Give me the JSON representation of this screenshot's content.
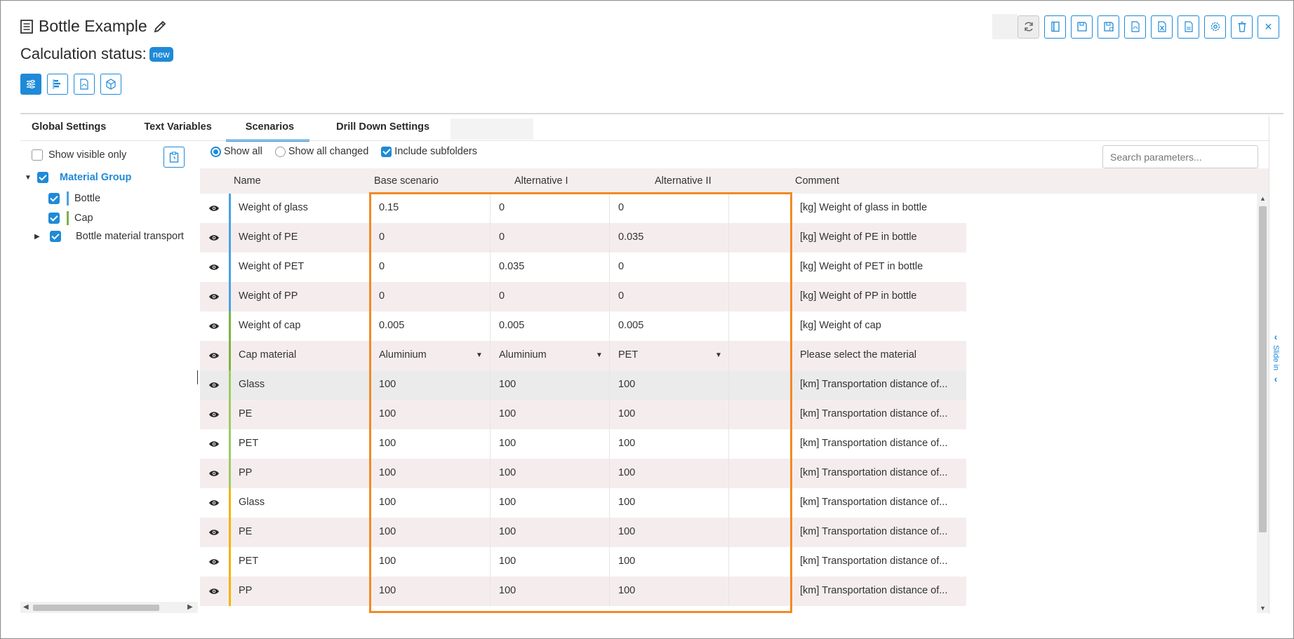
{
  "window": {
    "title": "Bottle Example",
    "status_label": "Calculation status:",
    "status_badge": "new"
  },
  "view_buttons": [
    "parameters-icon",
    "tree-structure-icon",
    "pdf-icon",
    "3d-model-icon"
  ],
  "toolbar_buttons": [
    "refresh-icon",
    "notebook-icon",
    "save-icon",
    "save-as-icon",
    "pdf-export-icon",
    "excel-export-icon",
    "csv-export-icon",
    "settings-icon",
    "delete-icon",
    "close-icon"
  ],
  "toolbar": {
    "close_label": "×"
  },
  "tabs": [
    {
      "label": "Global Settings",
      "active": false
    },
    {
      "label": "Text Variables",
      "active": false
    },
    {
      "label": "Scenarios",
      "active": true
    },
    {
      "label": "Drill Down Settings",
      "active": false
    }
  ],
  "tree": {
    "show_visible_only": "Show visible only",
    "items": [
      {
        "label": "Material Group",
        "checked": true,
        "color": "#1f8ad8"
      },
      {
        "label": "Bottle",
        "checked": true,
        "color": "#4aa3df"
      },
      {
        "label": "Cap",
        "checked": true,
        "color": "#7cb342"
      },
      {
        "label": "Bottle material transport",
        "checked": true,
        "color": ""
      }
    ]
  },
  "filters": {
    "show_all": "Show all",
    "show_all_changed": "Show all changed",
    "include_subfolders": "Include subfolders",
    "search_placeholder": "Search parameters..."
  },
  "table": {
    "columns": [
      "Name",
      "Base scenario",
      "Alternative I",
      "Alternative II",
      "Comment"
    ],
    "rows": [
      {
        "name": "Weight of glass",
        "base": "0.15",
        "alt1": "0",
        "alt2": "0",
        "comment": "[kg] Weight of glass in bottle",
        "color": "#4aa3df"
      },
      {
        "name": "Weight of PE",
        "base": "0",
        "alt1": "0",
        "alt2": "0.035",
        "comment": "[kg] Weight of PE in bottle",
        "color": "#4aa3df"
      },
      {
        "name": "Weight of PET",
        "base": "0",
        "alt1": "0.035",
        "alt2": "0",
        "comment": "[kg] Weight of PET in bottle",
        "color": "#4aa3df"
      },
      {
        "name": "Weight of PP",
        "base": "0",
        "alt1": "0",
        "alt2": "0",
        "comment": "[kg] Weight of PP in bottle",
        "color": "#4aa3df"
      },
      {
        "name": "Weight of cap",
        "base": "0.005",
        "alt1": "0.005",
        "alt2": "0.005",
        "comment": "[kg] Weight of cap",
        "color": "#7cb342"
      },
      {
        "name": "Cap material",
        "base": "Aluminium",
        "alt1": "Aluminium",
        "alt2": "PET",
        "comment": "Please select the material",
        "color": "#7cb342",
        "dropdown": true
      },
      {
        "name": "Glass",
        "base": "100",
        "alt1": "100",
        "alt2": "100",
        "comment": "[km] Transportation distance of...",
        "color": "#9ccc65"
      },
      {
        "name": "PE",
        "base": "100",
        "alt1": "100",
        "alt2": "100",
        "comment": "[km] Transportation distance of...",
        "color": "#9ccc65"
      },
      {
        "name": "PET",
        "base": "100",
        "alt1": "100",
        "alt2": "100",
        "comment": "[km] Transportation distance of...",
        "color": "#9ccc65"
      },
      {
        "name": "PP",
        "base": "100",
        "alt1": "100",
        "alt2": "100",
        "comment": "[km] Transportation distance of...",
        "color": "#9ccc65"
      },
      {
        "name": "Glass",
        "base": "100",
        "alt1": "100",
        "alt2": "100",
        "comment": "[km] Transportation distance of...",
        "color": "#f4b400"
      },
      {
        "name": "PE",
        "base": "100",
        "alt1": "100",
        "alt2": "100",
        "comment": "[km] Transportation distance of...",
        "color": "#f4b400"
      },
      {
        "name": "PET",
        "base": "100",
        "alt1": "100",
        "alt2": "100",
        "comment": "[km] Transportation distance of...",
        "color": "#f4b400"
      },
      {
        "name": "PP",
        "base": "100",
        "alt1": "100",
        "alt2": "100",
        "comment": "[km] Transportation distance of...",
        "color": "#f4b400"
      }
    ]
  },
  "side_panel": {
    "label": "Slide in"
  },
  "colors": {
    "accent": "#1f8ad8",
    "highlight_box": "#f08a24"
  }
}
